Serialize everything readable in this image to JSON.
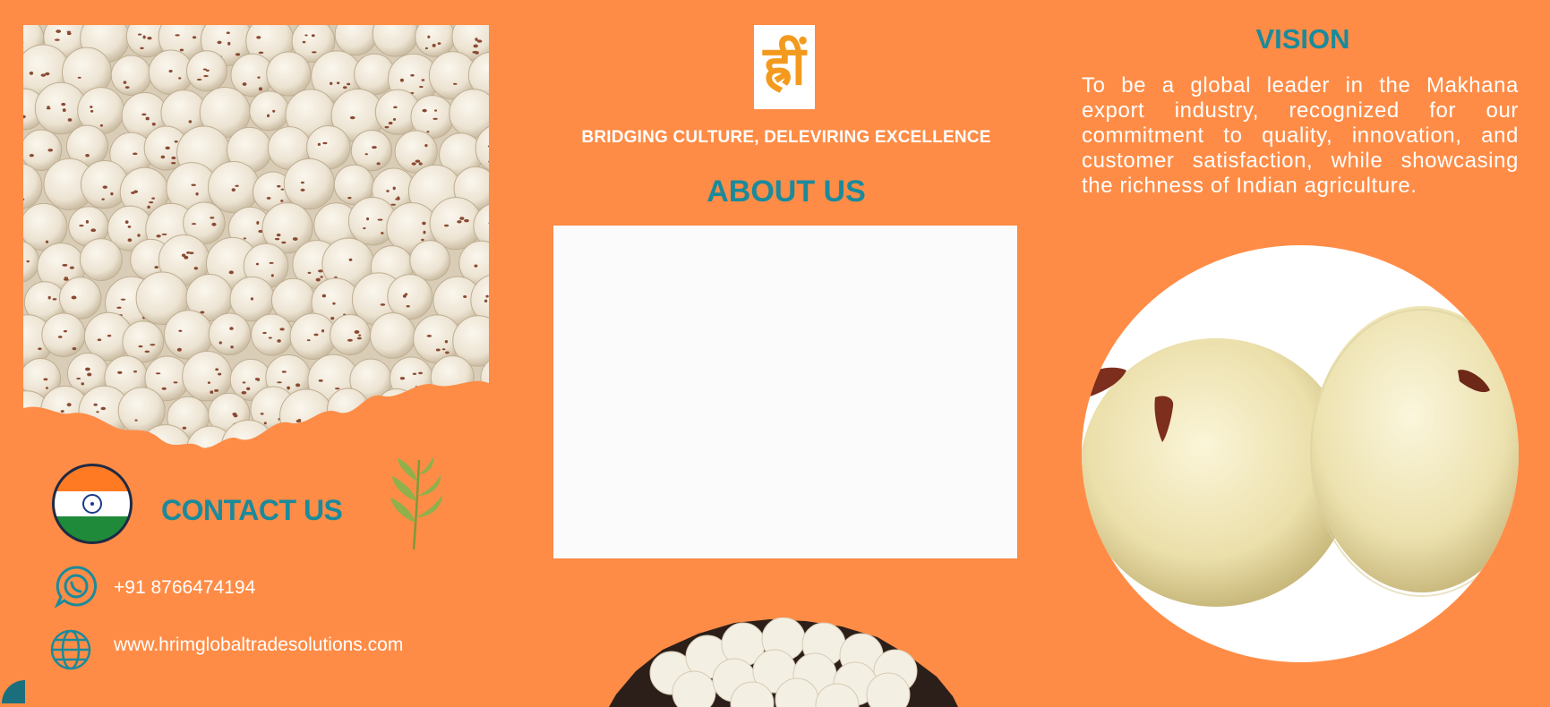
{
  "brand": {
    "logo_glyph": "ह्रीं",
    "tagline": "BRIDGING CULTURE, DELEVIRING EXCELLENCE"
  },
  "about": {
    "heading": "ABOUT US"
  },
  "contact": {
    "heading": "CONTACT US",
    "phone": "+91 8766474194",
    "website": "www.hrimglobaltradesolutions.com"
  },
  "vision": {
    "heading": "VISION",
    "text": "To be a global leader in the Makhana export industry, recognized for our commitment to quality, innovation, and customer satisfaction, while showcasing the richness of Indian agriculture."
  },
  "colors": {
    "background": "#ff8c46",
    "accent_teal": "#1b8a9b",
    "text_white": "#ffffff",
    "logo_orange": "#f39a1e"
  },
  "icons": {
    "flag": "india-flag-icon",
    "leaf": "leaf-sprig-icon",
    "whatsapp": "whatsapp-icon",
    "globe": "globe-icon"
  }
}
